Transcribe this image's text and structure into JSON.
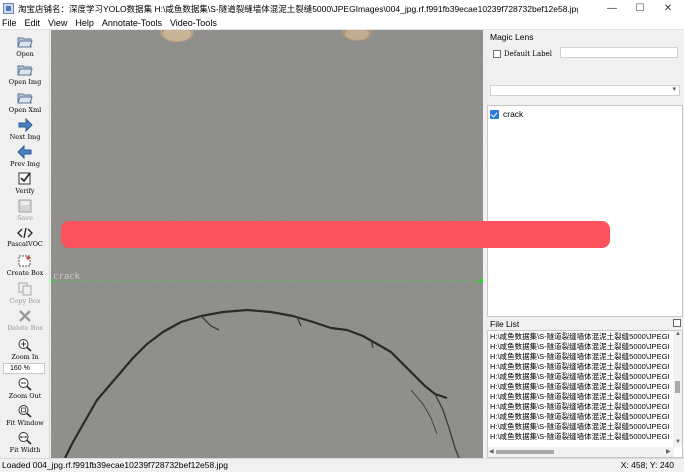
{
  "window": {
    "title": "淘宝店铺名：深度学习YOLO数据集 H:\\咸鱼数据集\\S-隧道裂缝墙体混泥土裂缝5000\\JPEGImages\\004_jpg.rf.f991fb39ecae10239f728732bef12e58.jpg",
    "minimize_glyph": "—",
    "maximize_glyph": "☐",
    "close_glyph": "✕"
  },
  "menu": [
    "File",
    "Edit",
    "View",
    "Help",
    "Annotate-Tools",
    "Video-Tools"
  ],
  "toolbar": {
    "tools": [
      {
        "label": "Open",
        "icon": "folder-open-icon",
        "enabled": true
      },
      {
        "label": "Open Img",
        "icon": "folder-open-icon",
        "enabled": true
      },
      {
        "label": "Open Xml",
        "icon": "folder-open-icon",
        "enabled": true
      },
      {
        "label": "Next Img",
        "icon": "arrow-right-icon",
        "enabled": true
      },
      {
        "label": "Prev Img",
        "icon": "arrow-left-icon",
        "enabled": true
      },
      {
        "label": "Verify",
        "icon": "checkbox-icon",
        "enabled": true
      },
      {
        "label": "Save",
        "icon": "save-icon",
        "enabled": false
      },
      {
        "label": "PascalVOC",
        "icon": "code-icon",
        "enabled": true
      },
      {
        "label": "Create Box",
        "icon": "create-box-icon",
        "enabled": true
      },
      {
        "label": "Copy Box",
        "icon": "copy-box-icon",
        "enabled": false
      },
      {
        "label": "Delete Box",
        "icon": "delete-box-icon",
        "enabled": false
      },
      {
        "label": "Zoom In",
        "icon": "zoom-in-icon",
        "enabled": true
      },
      {
        "label": "Zoom Out",
        "icon": "zoom-out-icon",
        "enabled": true
      },
      {
        "label": "Fit Window",
        "icon": "fit-window-icon",
        "enabled": true
      },
      {
        "label": "Fit Width",
        "icon": "fit-width-icon",
        "enabled": true
      }
    ],
    "zoom_value": "160 %"
  },
  "canvas": {
    "box_label": "crack"
  },
  "magic_lens": {
    "title": "Magic Lens",
    "default_label_text": "Default Label",
    "default_label_value": "",
    "combo_value": ""
  },
  "labels": [
    {
      "text": "crack",
      "checked": true
    }
  ],
  "file_list": {
    "title": "File List",
    "rows": [
      "H:\\咸鱼数据集\\S-隧道裂缝墙体混泥土裂缝5000\\JPEGI",
      "H:\\咸鱼数据集\\S-隧道裂缝墙体混泥土裂缝5000\\JPEGI",
      "H:\\咸鱼数据集\\S-隧道裂缝墙体混泥土裂缝5000\\JPEGI",
      "H:\\咸鱼数据集\\S-隧道裂缝墙体混泥土裂缝5000\\JPEGI",
      "H:\\咸鱼数据集\\S-隧道裂缝墙体混泥土裂缝5000\\JPEGI",
      "H:\\咸鱼数据集\\S-隧道裂缝墙体混泥土裂缝5000\\JPEGI",
      "H:\\咸鱼数据集\\S-隧道裂缝墙体混泥土裂缝5000\\JPEGI",
      "H:\\咸鱼数据集\\S-隧道裂缝墙体混泥土裂缝5000\\JPEGI",
      "H:\\咸鱼数据集\\S-隧道裂缝墙体混泥土裂缝5000\\JPEGI",
      "H:\\咸鱼数据集\\S-隧道裂缝墙体混泥土裂缝5000\\JPEGI",
      "H:\\咸鱼数据集\\S-隧道裂缝墙体混泥土裂缝5000\\JPEGI"
    ]
  },
  "status": {
    "message": "Loaded 004_jpg.rf.f991fb39ecae10239f728732bef12e58.jpg",
    "coords": "X: 458; Y: 240"
  },
  "colors": {
    "accent": "#2a7be0",
    "box_handle": "#2fd22f",
    "redaction": "#f9515d",
    "asphalt": "#8d8c8a"
  }
}
